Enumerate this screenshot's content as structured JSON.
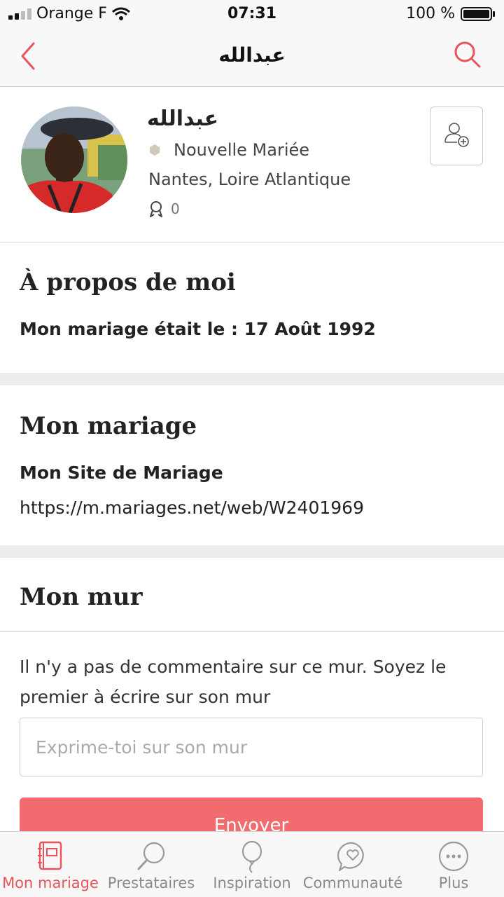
{
  "status_bar": {
    "carrier": "Orange F",
    "time": "07:31",
    "battery": "100 %"
  },
  "nav": {
    "title": "عبدالله"
  },
  "profile": {
    "name": "عبدالله",
    "role": "Nouvelle Mariée",
    "location": "Nantes, Loire Atlantique",
    "medals": "0"
  },
  "about": {
    "title": "À propos de moi",
    "wedding_date": "Mon mariage était le : 17 Août 1992"
  },
  "wedding": {
    "title": "Mon mariage",
    "site_label": "Mon Site de Mariage",
    "site_url": "https://m.mariages.net/web/W2401969"
  },
  "wall": {
    "title": "Mon mur",
    "empty_text": "Il n'y a pas de commentaire sur ce mur. Soyez le premier à écrire sur son mur",
    "input_placeholder": "Exprime-toi sur son mur",
    "send_label": "Envoyer"
  },
  "tabs": [
    {
      "label": "Mon mariage",
      "icon": "planner-book-icon",
      "active": true
    },
    {
      "label": "Prestataires",
      "icon": "magnifier-icon",
      "active": false
    },
    {
      "label": "Inspiration",
      "icon": "balloon-icon",
      "active": false
    },
    {
      "label": "Communauté",
      "icon": "chat-heart-icon",
      "active": false
    },
    {
      "label": "Plus",
      "icon": "more-dots-icon",
      "active": false
    }
  ],
  "colors": {
    "accent": "#e8545a",
    "button": "#f26b6f",
    "separator": "#ededed"
  }
}
